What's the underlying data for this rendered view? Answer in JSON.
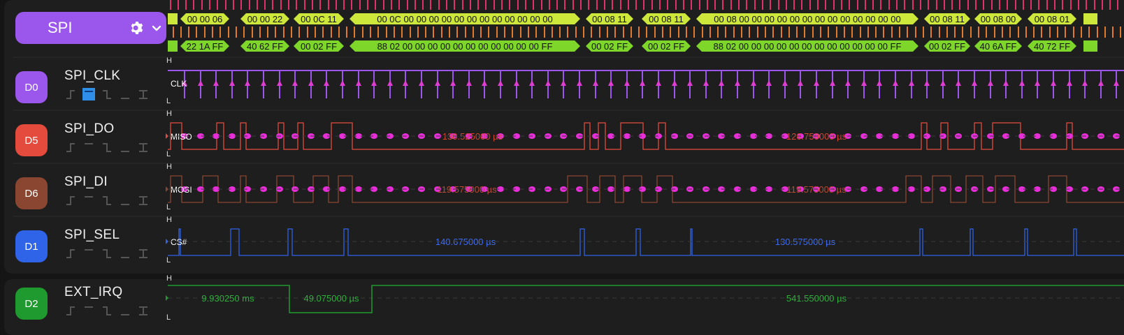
{
  "analyzer": {
    "label": "SPI"
  },
  "channels": [
    {
      "id": "D0",
      "name": "SPI_CLK",
      "color": "#9b57ec",
      "annotation": "CLK"
    },
    {
      "id": "D5",
      "name": "SPI_DO",
      "color": "#e44b3c",
      "annotation": "MISO",
      "measure1": "130.525000 µs",
      "measure2": "126.750000 µs"
    },
    {
      "id": "D6",
      "name": "SPI_DI",
      "color": "#8a4630",
      "annotation": "MOSI",
      "measure1": "119.575000 µs",
      "measure2": "119.575000 µs"
    },
    {
      "id": "D1",
      "name": "SPI_SEL",
      "color": "#2f63e8",
      "annotation": "CS#",
      "measure1": "140.675000 µs",
      "measure2": "130.575000 µs"
    },
    {
      "id": "D2",
      "name": "EXT_IRQ",
      "color": "#1f9a2f",
      "measure1": "9.930250 ms",
      "measure2": "49.075000 µs",
      "measure3": "541.550000 µs"
    }
  ],
  "level_labels": {
    "high": "H",
    "low": "L"
  },
  "decoder": {
    "top_row": [
      "00 00 06",
      "00 00 22",
      "00 0C 11",
      "00 0C 00 00 00 00 00 00 00 00 00 00 00 00",
      "00 08 11",
      "00 08 11",
      "00 08 00 00 00 00 00 00 00 00 00 00 00 00 00",
      "00 08 11",
      "00 08 00",
      "00 08 01"
    ],
    "bottom_row": [
      "22 1A FF",
      "40 62 FF",
      "00 02 FF",
      "88 02 00 00 00 00 00 00 00 00 00 00 00 FF",
      "00 02 FF",
      "00 02 FF",
      "88 02 00 00 00 00 00 00 00 00 00 00 00 00 FF",
      "00 02 FF",
      "40 6A FF",
      "40 72 FF"
    ],
    "top_color": "#cde83a",
    "bottom_color": "#7ed62a"
  }
}
